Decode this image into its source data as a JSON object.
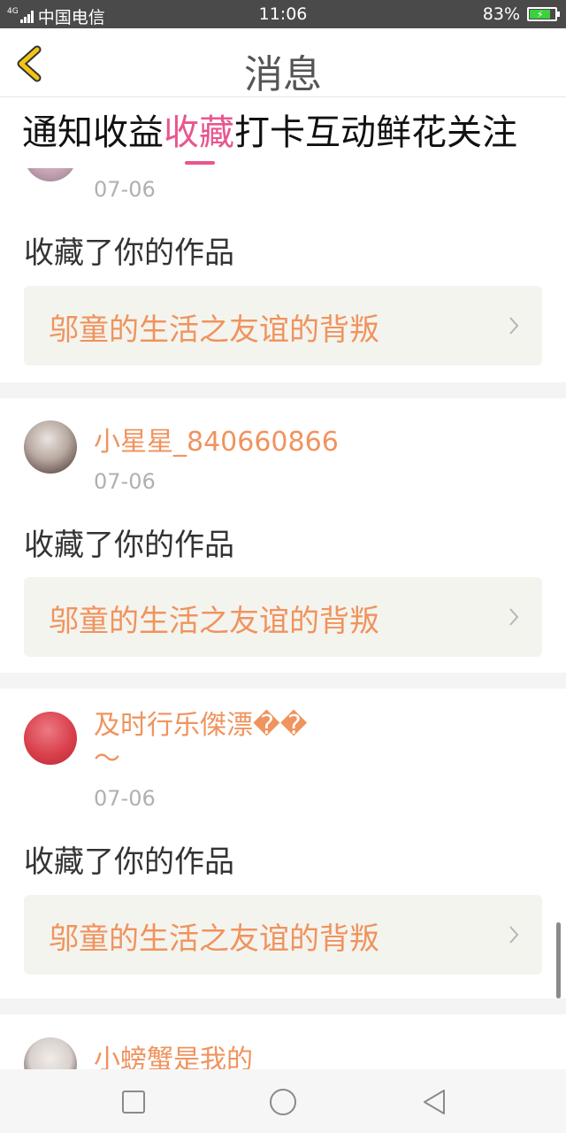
{
  "status_bar": {
    "network": "4G",
    "carrier": "中国电信",
    "time": "11:06",
    "battery": "83%"
  },
  "header": {
    "title": "消息",
    "back_icon": "chevron-left-icon"
  },
  "tabs": [
    {
      "label": "通知",
      "active": false
    },
    {
      "label": "收益",
      "active": false
    },
    {
      "label": "收藏",
      "active": true
    },
    {
      "label": "打卡",
      "active": false
    },
    {
      "label": "互动",
      "active": false
    },
    {
      "label": "鲜花",
      "active": false
    },
    {
      "label": "关注",
      "active": false
    }
  ],
  "messages": [
    {
      "name": "",
      "date": "07-06",
      "action": "收藏了你的作品",
      "work": "邬童的生活之友谊的背叛"
    },
    {
      "name": "小星星_840660866",
      "date": "07-06",
      "action": "收藏了你的作品",
      "work": "邬童的生活之友谊的背叛"
    },
    {
      "name": "及时行乐傑漂��",
      "name_line2": "～",
      "date": "07-06",
      "action": "收藏了你的作品",
      "work": "邬童的生活之友谊的背叛"
    },
    {
      "name": "小螃蟹是我的"
    }
  ],
  "colors": {
    "accent": "#e8568f",
    "name_orange": "#f0935e",
    "back_yellow": "#f3c515"
  }
}
